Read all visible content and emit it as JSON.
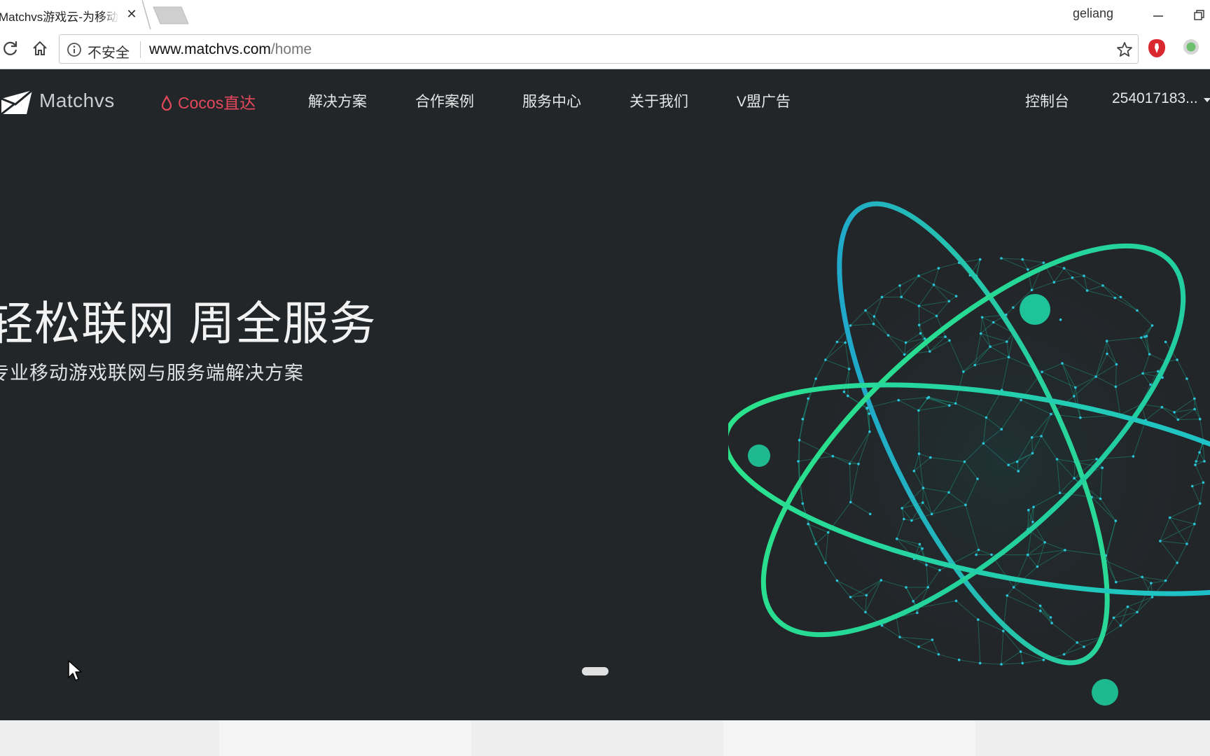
{
  "browser": {
    "tab_title": "Matchvs游戏云-为移动游戏",
    "tab_close": "✕",
    "profile_name": "geliang",
    "security_label": "不安全",
    "url_host": "www.matchvs.com",
    "url_path": "/home"
  },
  "nav": {
    "logo_text": "Matchvs",
    "cocos_label": "Cocos直达",
    "items": [
      {
        "label": "解决方案"
      },
      {
        "label": "合作案例"
      },
      {
        "label": "服务中心"
      },
      {
        "label": "关于我们"
      },
      {
        "label": "V盟广告"
      }
    ],
    "console_label": "控制台",
    "user_label": "254017183..."
  },
  "hero": {
    "title": "轻松联网 周全服务",
    "subtitle": "专业移动游戏联网与服务端解决方案"
  },
  "carousel": {
    "slide_count": 1,
    "active_index": 0
  },
  "colors": {
    "page_bg": "#232629",
    "accent_red": "#e5485a",
    "orbit_green": "#2be38a",
    "orbit_blue": "#1e9fd6",
    "strip_bg": "#eeeeee"
  },
  "icons": {
    "reload": "reload-icon",
    "home": "home-icon",
    "info": "info-icon",
    "star": "star-icon",
    "cursor": "mouse-cursor-icon"
  }
}
